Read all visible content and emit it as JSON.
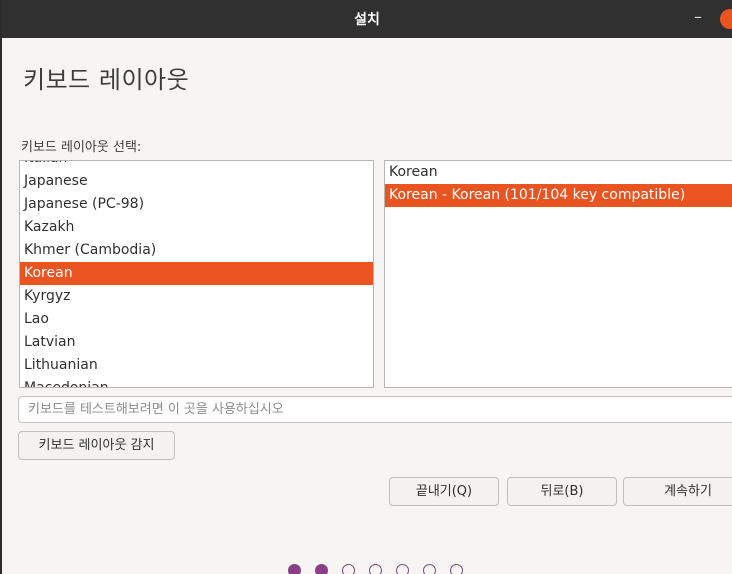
{
  "window": {
    "title": "설치",
    "minimize_glyph": "–",
    "accent_color": "#e95420"
  },
  "page": {
    "title": "키보드 레이아웃"
  },
  "layout_selector": {
    "label": "키보드 레이아웃 선택:",
    "languages": [
      {
        "label": "Italian",
        "selected": false
      },
      {
        "label": "Japanese",
        "selected": false
      },
      {
        "label": "Japanese (PC-98)",
        "selected": false
      },
      {
        "label": "Kazakh",
        "selected": false
      },
      {
        "label": "Khmer (Cambodia)",
        "selected": false
      },
      {
        "label": "Korean",
        "selected": true
      },
      {
        "label": "Kyrgyz",
        "selected": false
      },
      {
        "label": "Lao",
        "selected": false
      },
      {
        "label": "Latvian",
        "selected": false
      },
      {
        "label": "Lithuanian",
        "selected": false
      },
      {
        "label": "Macedonian",
        "selected": false
      }
    ],
    "variants": [
      {
        "label": "Korean",
        "selected": false
      },
      {
        "label": "Korean - Korean (101/104 key compatible)",
        "selected": true
      }
    ]
  },
  "test_field": {
    "placeholder": "키보드를 테스트해보려면 이 곳을 사용하십시오",
    "value": ""
  },
  "buttons": {
    "detect": "키보드 레이아웃 감지",
    "quit": "끝내기(Q)",
    "back": "뒤로(B)",
    "continue": "계속하기"
  },
  "progress": {
    "total_steps": 7,
    "completed_steps": 2
  }
}
